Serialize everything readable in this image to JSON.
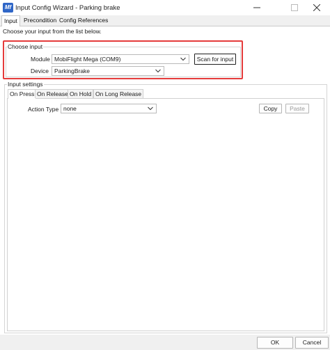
{
  "window": {
    "title": "Input Config Wizard - Parking brake",
    "app_icon": "Mf",
    "controls": [
      "minimize-icon",
      "maximize-icon",
      "close-icon"
    ]
  },
  "tabs": [
    "Input",
    "Precondition",
    "Config References"
  ],
  "active_tab": "Input",
  "hint": "Choose your input from the list below.",
  "choose_input": {
    "legend": "Choose input",
    "module_label": "Module",
    "module_value": "MobiFlight Mega (COM9)",
    "device_label": "Device",
    "device_value": "ParkingBrake",
    "scan_button": "Scan for input",
    "highlight_color": "#e53b3b"
  },
  "input_settings": {
    "legend": "Input settings",
    "tabs": [
      "On Press",
      "On Release",
      "On Hold",
      "On Long Release"
    ],
    "active_tab": "On Press",
    "action_type_label": "Action Type",
    "action_type_value": "none",
    "copy_button": "Copy",
    "paste_button": "Paste"
  },
  "footer": {
    "ok_button": "OK",
    "cancel_button": "Cancel"
  }
}
